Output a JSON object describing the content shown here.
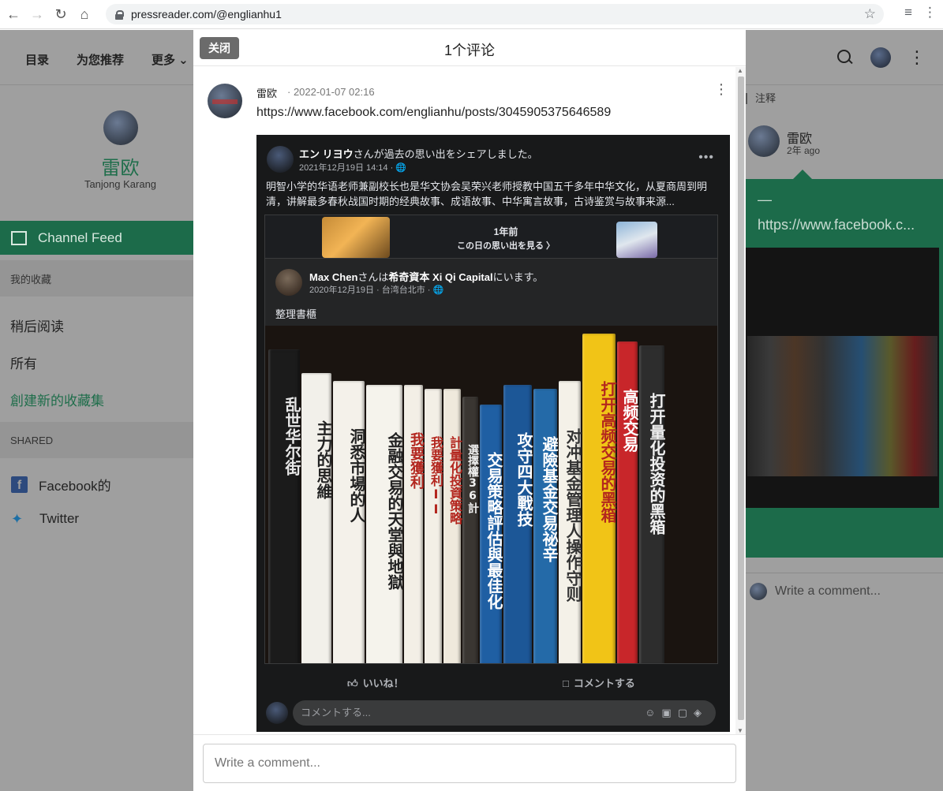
{
  "browser": {
    "url": "pressreader.com/@englianhu1"
  },
  "topnav": {
    "items": [
      "目录",
      "为您推荐",
      "更多 ⌄"
    ]
  },
  "sidebar": {
    "profile_name": "雷欧",
    "profile_location": "Tanjong Karang",
    "channel_feed": "Channel Feed",
    "my_collections": "我的收藏",
    "read_later": "稍后阅读",
    "all": "所有",
    "create_collection": "創建新的收藏集",
    "shared": "SHARED",
    "facebook": "Facebook的",
    "twitter": "Twitter"
  },
  "rightcol": {
    "note_label": "注释",
    "name": "雷欧",
    "ago": "2年 ago",
    "bubble_dash": "—",
    "bubble_link": "https://www.facebook.c...",
    "write_comment": "Write a comment..."
  },
  "modal": {
    "close_label": "关闭",
    "title": "1个评论",
    "comment": {
      "author": "雷欧",
      "date": "· 2022-01-07 02:16",
      "text": "https://www.facebook.com/englianhu/posts/3045905375646589"
    },
    "fb": {
      "name_bold": "エン リヨウ",
      "name_rest": "さんが過去の思い出をシェアしました。",
      "time": "2021年12月19日 14:14 · 🌐",
      "body": "明智小学的华语老师兼副校长也是华文协会吴荣兴老师授教中国五千多年中华文化，从夏商周到明清，讲解最多春秋战国时期的经典故事、成语故事、中华寓言故事，古诗鉴赏与故事来源...",
      "memory_line1": "1年前",
      "memory_line2": "この日の思い出を見る 〉",
      "inner_name_bold": "Max Chen",
      "inner_name_mid": "さんは",
      "inner_place_bold": "希奇資本 Xi Qi Capital",
      "inner_name_end": "にいます。",
      "inner_time": "2020年12月19日 · 台湾台北市 · 🌐",
      "inner_text": "整理書櫃",
      "like_label": "いいね！",
      "comment_label": "コメントする",
      "comment_placeholder": "コメントする..."
    },
    "write_placeholder": "Write a comment..."
  },
  "books": [
    {
      "title": "乱世华尔街",
      "color": "#1b1b1b",
      "text_color": "#e8e8e8"
    },
    {
      "title": "主力的思維",
      "color": "#f2f0ea",
      "text_color": "#222"
    },
    {
      "title": "洞悉市場的人",
      "color": "#f4f1ea",
      "text_color": "#222"
    },
    {
      "title": "金融交易的天堂與地獄",
      "color": "#f5f3ec",
      "text_color": "#222"
    },
    {
      "title": "我要獲利",
      "color": "#f3efe6",
      "text_color": "#b3261e"
    },
    {
      "title": "我要獲利II",
      "color": "#f3efe6",
      "text_color": "#b3261e"
    },
    {
      "title": "計量化投資策略",
      "color": "#efe9dc",
      "text_color": "#b3261e"
    },
    {
      "title": "選擇權36計",
      "color": "#3a3632",
      "text_color": "#f0f0f0"
    },
    {
      "title": "交易策略評估與最佳化",
      "color": "#1f5fa3",
      "text_color": "#fff"
    },
    {
      "title": "攻守四大戰技",
      "color": "#1c5797",
      "text_color": "#fff"
    },
    {
      "title": "避險基金交易祕辛",
      "color": "#246aa8",
      "text_color": "#fff"
    },
    {
      "title": "对冲基金管理人操作守则",
      "color": "#f4f1e8",
      "text_color": "#333"
    },
    {
      "title": "打开高频交易的黑箱",
      "color": "#f1c417",
      "text_color": "#b3261e"
    },
    {
      "title": "高频交易",
      "color": "#c8262a",
      "text_color": "#fff"
    },
    {
      "title": "打开量化投资的黑箱",
      "color": "#2d2d2d",
      "text_color": "#f0f0f0"
    }
  ],
  "icons": {
    "back": "back-arrow-icon",
    "forward": "forward-arrow-icon",
    "reload": "reload-icon",
    "home": "home-icon",
    "lock": "lock-icon",
    "star": "star-icon"
  },
  "colors": {
    "brand_green": "#1c6b4a",
    "modal_bg": "#ffffff",
    "overlay": "#9e9e9e"
  }
}
